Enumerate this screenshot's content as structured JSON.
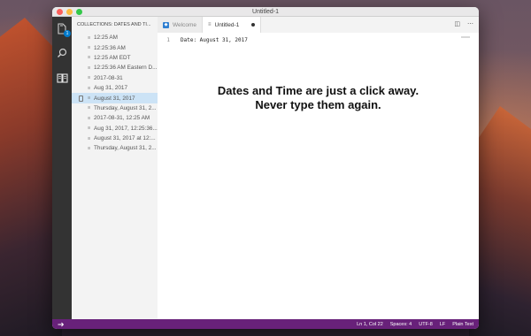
{
  "window": {
    "title": "Untitled-1"
  },
  "activity_bar": {
    "explorer_badge": "1"
  },
  "sidebar": {
    "header": "COLLECTIONS: DATES AND TI...",
    "items": [
      {
        "label": "12:25 AM"
      },
      {
        "label": "12:25:36 AM"
      },
      {
        "label": "12:25 AM EDT"
      },
      {
        "label": "12:25:36 AM Eastern D..."
      },
      {
        "label": "2017-08-31"
      },
      {
        "label": "Aug 31, 2017"
      },
      {
        "label": "August 31, 2017"
      },
      {
        "label": "Thursday, August 31, 2..."
      },
      {
        "label": "2017-08-31, 12:25 AM"
      },
      {
        "label": "Aug 31, 2017, 12:25:36..."
      },
      {
        "label": "August 31, 2017 at 12:..."
      },
      {
        "label": "Thursday, August 31, 2..."
      }
    ],
    "selected_index": 6
  },
  "tabs": [
    {
      "label": "Welcome",
      "active": false
    },
    {
      "label": "Untitled-1",
      "active": true,
      "dirty": true
    }
  ],
  "editor": {
    "lines": [
      {
        "number": "1",
        "text": "Date: August 31, 2017"
      }
    ],
    "overlay_line1": "Dates and Time are just a click away.",
    "overlay_line2": "Never type them again."
  },
  "statusbar": {
    "position": "Ln 1, Col 22",
    "indentation": "Spaces: 4",
    "encoding": "UTF-8",
    "eol": "LF",
    "language": "Plain Text"
  },
  "colors": {
    "statusbar": "#68217a",
    "activity_bar": "#333333",
    "selection": "#cce3f6",
    "badge": "#007acc"
  }
}
